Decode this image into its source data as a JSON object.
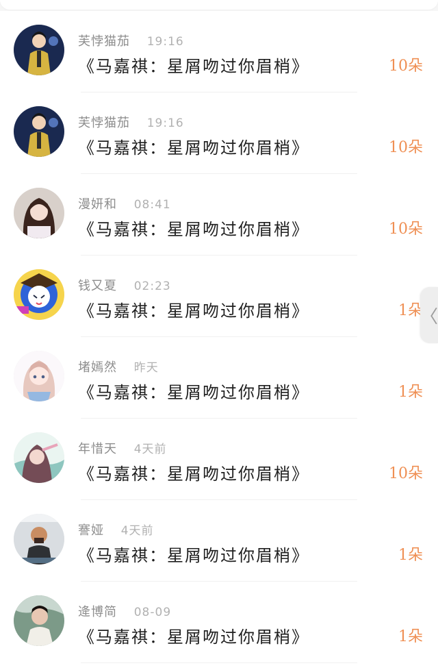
{
  "sheet": {
    "has_top_handle": true
  },
  "items": [
    {
      "user": "芙悖猫茄",
      "time": "19:16",
      "title": "《马嘉祺：星屑吻过你眉梢》",
      "count": "10朵",
      "avatar_icon": "user-avatar-performer-yellow"
    },
    {
      "user": "芙悖猫茄",
      "time": "19:16",
      "title": "《马嘉祺：星屑吻过你眉梢》",
      "count": "10朵",
      "avatar_icon": "user-avatar-performer-yellow"
    },
    {
      "user": "漫妍和",
      "time": "08:41",
      "title": "《马嘉祺：星屑吻过你眉梢》",
      "count": "10朵",
      "avatar_icon": "user-avatar-girl-photo"
    },
    {
      "user": "钱又夏",
      "time": "02:23",
      "title": "《马嘉祺：星屑吻过你眉梢》",
      "count": "1朵",
      "avatar_icon": "user-avatar-cartoon-blue"
    },
    {
      "user": "堵嫣然",
      "time": "昨天",
      "title": "《马嘉祺：星屑吻过你眉梢》",
      "count": "1朵",
      "avatar_icon": "user-avatar-anime-girl"
    },
    {
      "user": "年惜天",
      "time": "4天前",
      "title": "《马嘉祺：星屑吻过你眉梢》",
      "count": "10朵",
      "avatar_icon": "user-avatar-watercolor-girl"
    },
    {
      "user": "謇娅",
      "time": "4天前",
      "title": "《马嘉祺：星屑吻过你眉梢》",
      "count": "1朵",
      "avatar_icon": "user-avatar-street-photo"
    },
    {
      "user": "逄博简",
      "time": "08-09",
      "title": "《马嘉祺：星屑吻过你眉梢》",
      "count": "1朵",
      "avatar_icon": "user-avatar-young-man"
    }
  ],
  "side_handle": {
    "glyph": "〈"
  },
  "colors": {
    "background": "#f6f6f6",
    "card": "#ffffff",
    "title": "#1f1f1f",
    "meta": "#8d8d8d",
    "time": "#b1b1b1",
    "accent": "#ef8f53"
  }
}
